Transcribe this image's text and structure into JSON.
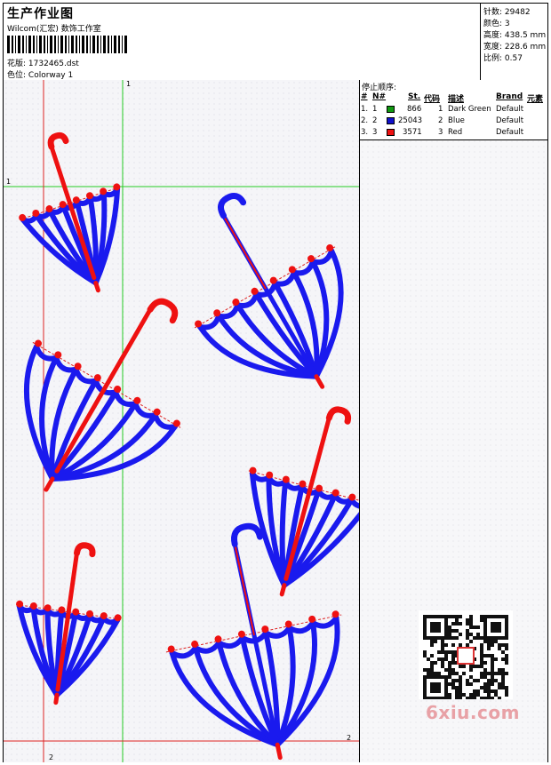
{
  "header": {
    "title": "生产作业图",
    "studio": "Wilcom(汇宏) 数饰工作室",
    "design_label": "花版:",
    "design_value": "1732465.dst",
    "colorway_label": "色位:",
    "colorway_value": "Colorway 1"
  },
  "stats": {
    "stitches_label": "针数:",
    "stitches_value": "29482",
    "colors_label": "颜色:",
    "colors_value": "3",
    "height_label": "高度:",
    "height_value": "438.5 mm",
    "width_label": "宽度:",
    "width_value": "228.6 mm",
    "scale_label": "比例:",
    "scale_value": "0.57"
  },
  "stop_sequence": {
    "title": "停止顺序:",
    "columns": [
      "#",
      "N#",
      "St.",
      "代码",
      "描述",
      "Brand",
      "元素"
    ],
    "rows": [
      {
        "num": "1.",
        "n": "1",
        "color": "#119911",
        "st": "866",
        "code": "1",
        "desc": "Dark Green",
        "brand": "Default"
      },
      {
        "num": "2.",
        "n": "2",
        "color": "#1111cc",
        "st": "25043",
        "code": "2",
        "desc": "Blue",
        "brand": "Default"
      },
      {
        "num": "3.",
        "n": "3",
        "color": "#ee1111",
        "st": "3571",
        "code": "3",
        "desc": "Red",
        "brand": "Default"
      }
    ]
  },
  "guides": {
    "label_1": "1",
    "label_2": "2"
  },
  "watermark": "6xiu.com",
  "colors": {
    "blue": "#1a1aee",
    "red": "#ee1111",
    "green": "#22cc22",
    "redline": "#dd2222"
  }
}
